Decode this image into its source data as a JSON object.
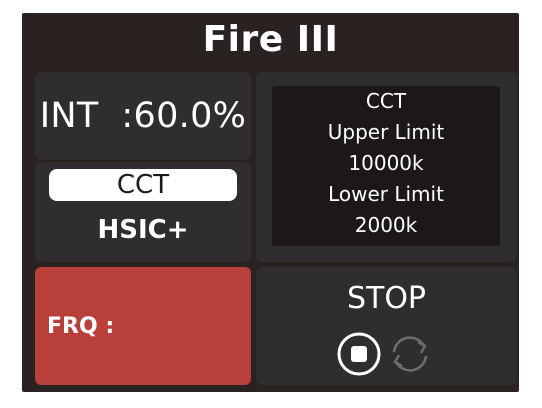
{
  "header": {
    "title": "Fire III"
  },
  "intensity": {
    "text": "INT  :60.0%"
  },
  "mode": {
    "selected": "CCT",
    "other": "HSIC+"
  },
  "limits": {
    "heading": "CCT",
    "upper_label": "Upper Limit",
    "upper_value": "10000k",
    "lower_label": "Lower Limit",
    "lower_value": "2000k"
  },
  "frequency": {
    "label": "FRQ :"
  },
  "playback": {
    "label": "STOP",
    "icons": [
      "stop-icon",
      "loop-icon"
    ]
  },
  "colors": {
    "screen": "#2a2121",
    "panel": "#2f2d2f",
    "frq": "#b9403a",
    "text": "#ffffff"
  }
}
